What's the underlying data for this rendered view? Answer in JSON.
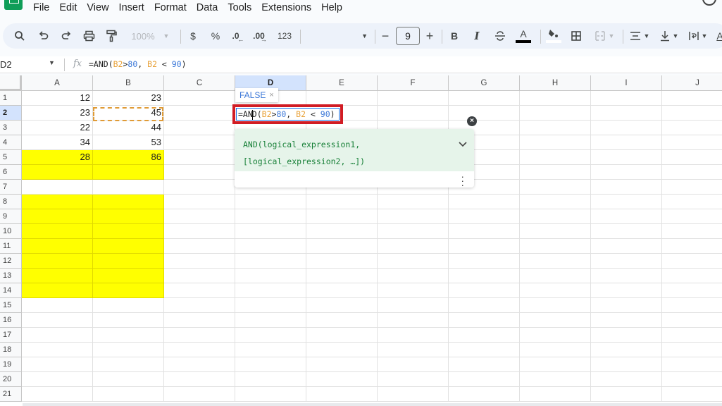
{
  "menubar": {
    "items": [
      "File",
      "Edit",
      "View",
      "Insert",
      "Format",
      "Data",
      "Tools",
      "Extensions",
      "Help"
    ]
  },
  "toolbar": {
    "zoom": "100%",
    "currency": "$",
    "percent": "%",
    "decrease_decimal": ".0",
    "increase_decimal": ".00",
    "number_format": "123",
    "font_size": "9",
    "minus": "−",
    "plus": "+",
    "bold": "B",
    "italic": "I",
    "strike": "S",
    "text_color": "A"
  },
  "formula_bar": {
    "name_box": "D2",
    "fx": "fx",
    "formula_parts": [
      "=AND(",
      "B2",
      ">",
      "80",
      ", ",
      "B2",
      " < ",
      "90",
      ")"
    ]
  },
  "grid": {
    "columns": [
      "A",
      "B",
      "C",
      "D",
      "E",
      "F",
      "G",
      "H",
      "I",
      "J"
    ],
    "selected_column": "D",
    "rows": [
      "1",
      "2",
      "3",
      "4",
      "5",
      "6",
      "7",
      "8",
      "9",
      "10",
      "11",
      "12",
      "13",
      "14",
      "15",
      "16",
      "17",
      "18",
      "19",
      "20",
      "21"
    ],
    "selected_row": "2",
    "data": [
      {
        "A": "12",
        "B": "23"
      },
      {
        "A": "23",
        "B": "45"
      },
      {
        "A": "22",
        "B": "44"
      },
      {
        "A": "34",
        "B": "53"
      },
      {
        "A": "28",
        "B": "86"
      }
    ],
    "highlight_color": "#ffff00"
  },
  "editor": {
    "result_preview": "FALSE",
    "result_close": "×",
    "text_before_caret": "=AN",
    "text_after_caret_parts": [
      "D(",
      "B2",
      ">",
      "80",
      ", ",
      "B2",
      " < ",
      "90",
      ")"
    ]
  },
  "help": {
    "signature_line1": "AND(logical_expression1,",
    "signature_line2": "[logical_expression2, …])",
    "chevron": "⌄",
    "more": "⋮",
    "close": "×"
  }
}
